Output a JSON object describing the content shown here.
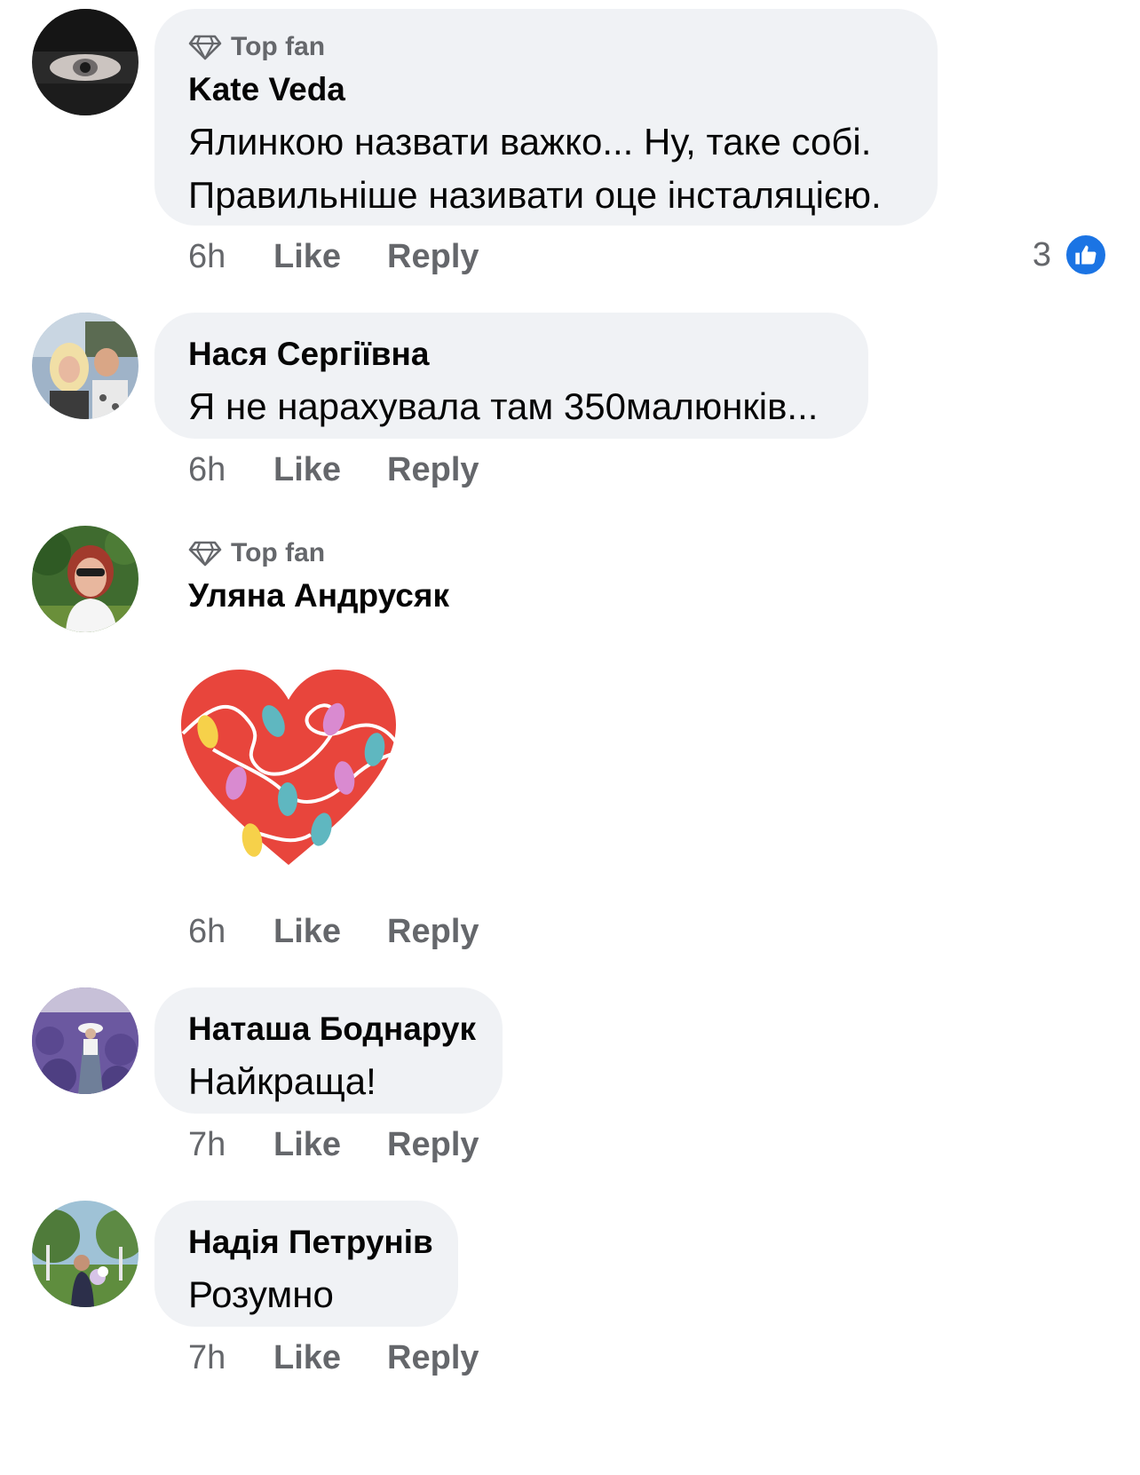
{
  "comments": [
    {
      "top_fan": "Top fan",
      "author": "Kate Veda",
      "lines": [
        "Ялинкою назвати важко... Ну, таке собі.",
        "Правильніше називати оце інсталяцією."
      ],
      "time": "6h",
      "like": "Like",
      "reply": "Reply",
      "reaction_count": "3"
    },
    {
      "author": "Нася Сергіївна",
      "lines": [
        "Я не нарахувала там 350малюнків..."
      ],
      "time": "6h",
      "like": "Like",
      "reply": "Reply"
    },
    {
      "top_fan": "Top fan",
      "author": "Уляна Андрусяк",
      "sticker": "heart-lights-sticker",
      "time": "6h",
      "like": "Like",
      "reply": "Reply"
    },
    {
      "author": "Наташа Боднарук",
      "lines": [
        "Найкраща!"
      ],
      "time": "7h",
      "like": "Like",
      "reply": "Reply"
    },
    {
      "author": "Надія Петрунів",
      "lines": [
        "Розумно"
      ],
      "time": "7h",
      "like": "Like",
      "reply": "Reply"
    }
  ],
  "colors": {
    "bubble": "#f0f2f5",
    "meta_text": "#65676b",
    "like_badge": "#1b74e4",
    "heart": "#e8453c"
  }
}
